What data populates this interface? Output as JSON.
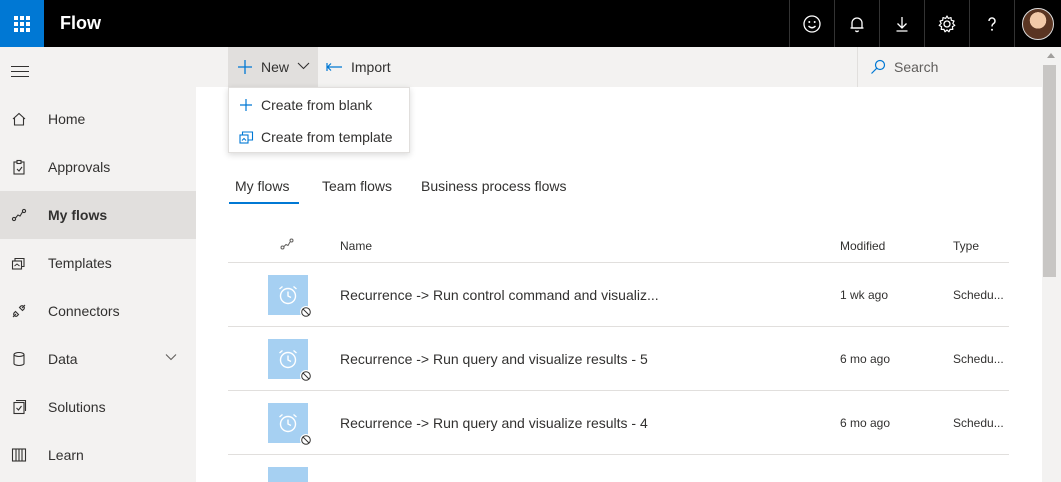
{
  "app": {
    "title": "Flow"
  },
  "topbar": {
    "icons": [
      "smiley-icon",
      "bell-icon",
      "download-icon",
      "gear-icon",
      "help-icon"
    ]
  },
  "sidebar": {
    "items": [
      {
        "label": "Home",
        "icon": "home-icon"
      },
      {
        "label": "Approvals",
        "icon": "approvals-icon"
      },
      {
        "label": "My flows",
        "icon": "flow-icon",
        "active": true
      },
      {
        "label": "Templates",
        "icon": "templates-icon"
      },
      {
        "label": "Connectors",
        "icon": "connectors-icon"
      },
      {
        "label": "Data",
        "icon": "data-icon",
        "expandable": true
      },
      {
        "label": "Solutions",
        "icon": "solutions-icon"
      },
      {
        "label": "Learn",
        "icon": "learn-icon"
      }
    ]
  },
  "commandbar": {
    "new_label": "New",
    "import_label": "Import",
    "search_placeholder": "Search"
  },
  "new_menu": {
    "items": [
      {
        "label": "Create from blank",
        "icon": "plus-icon"
      },
      {
        "label": "Create from template",
        "icon": "template-icon"
      }
    ]
  },
  "tabs": [
    {
      "label": "My flows",
      "active": true
    },
    {
      "label": "Team flows"
    },
    {
      "label": "Business process flows"
    }
  ],
  "table": {
    "columns": {
      "name": "Name",
      "modified": "Modified",
      "type": "Type"
    },
    "rows": [
      {
        "name": "Recurrence -> Run control command and visualiz...",
        "modified": "1 wk ago",
        "type": "Schedu..."
      },
      {
        "name": "Recurrence -> Run query and visualize results - 5",
        "modified": "6 mo ago",
        "type": "Schedu..."
      },
      {
        "name": "Recurrence -> Run query and visualize results - 4",
        "modified": "6 mo ago",
        "type": "Schedu..."
      }
    ]
  },
  "colors": {
    "accent": "#0078d4",
    "topbar": "#000000",
    "sidebar": "#f3f2f1",
    "flow_tile": "#a6d0f2"
  }
}
